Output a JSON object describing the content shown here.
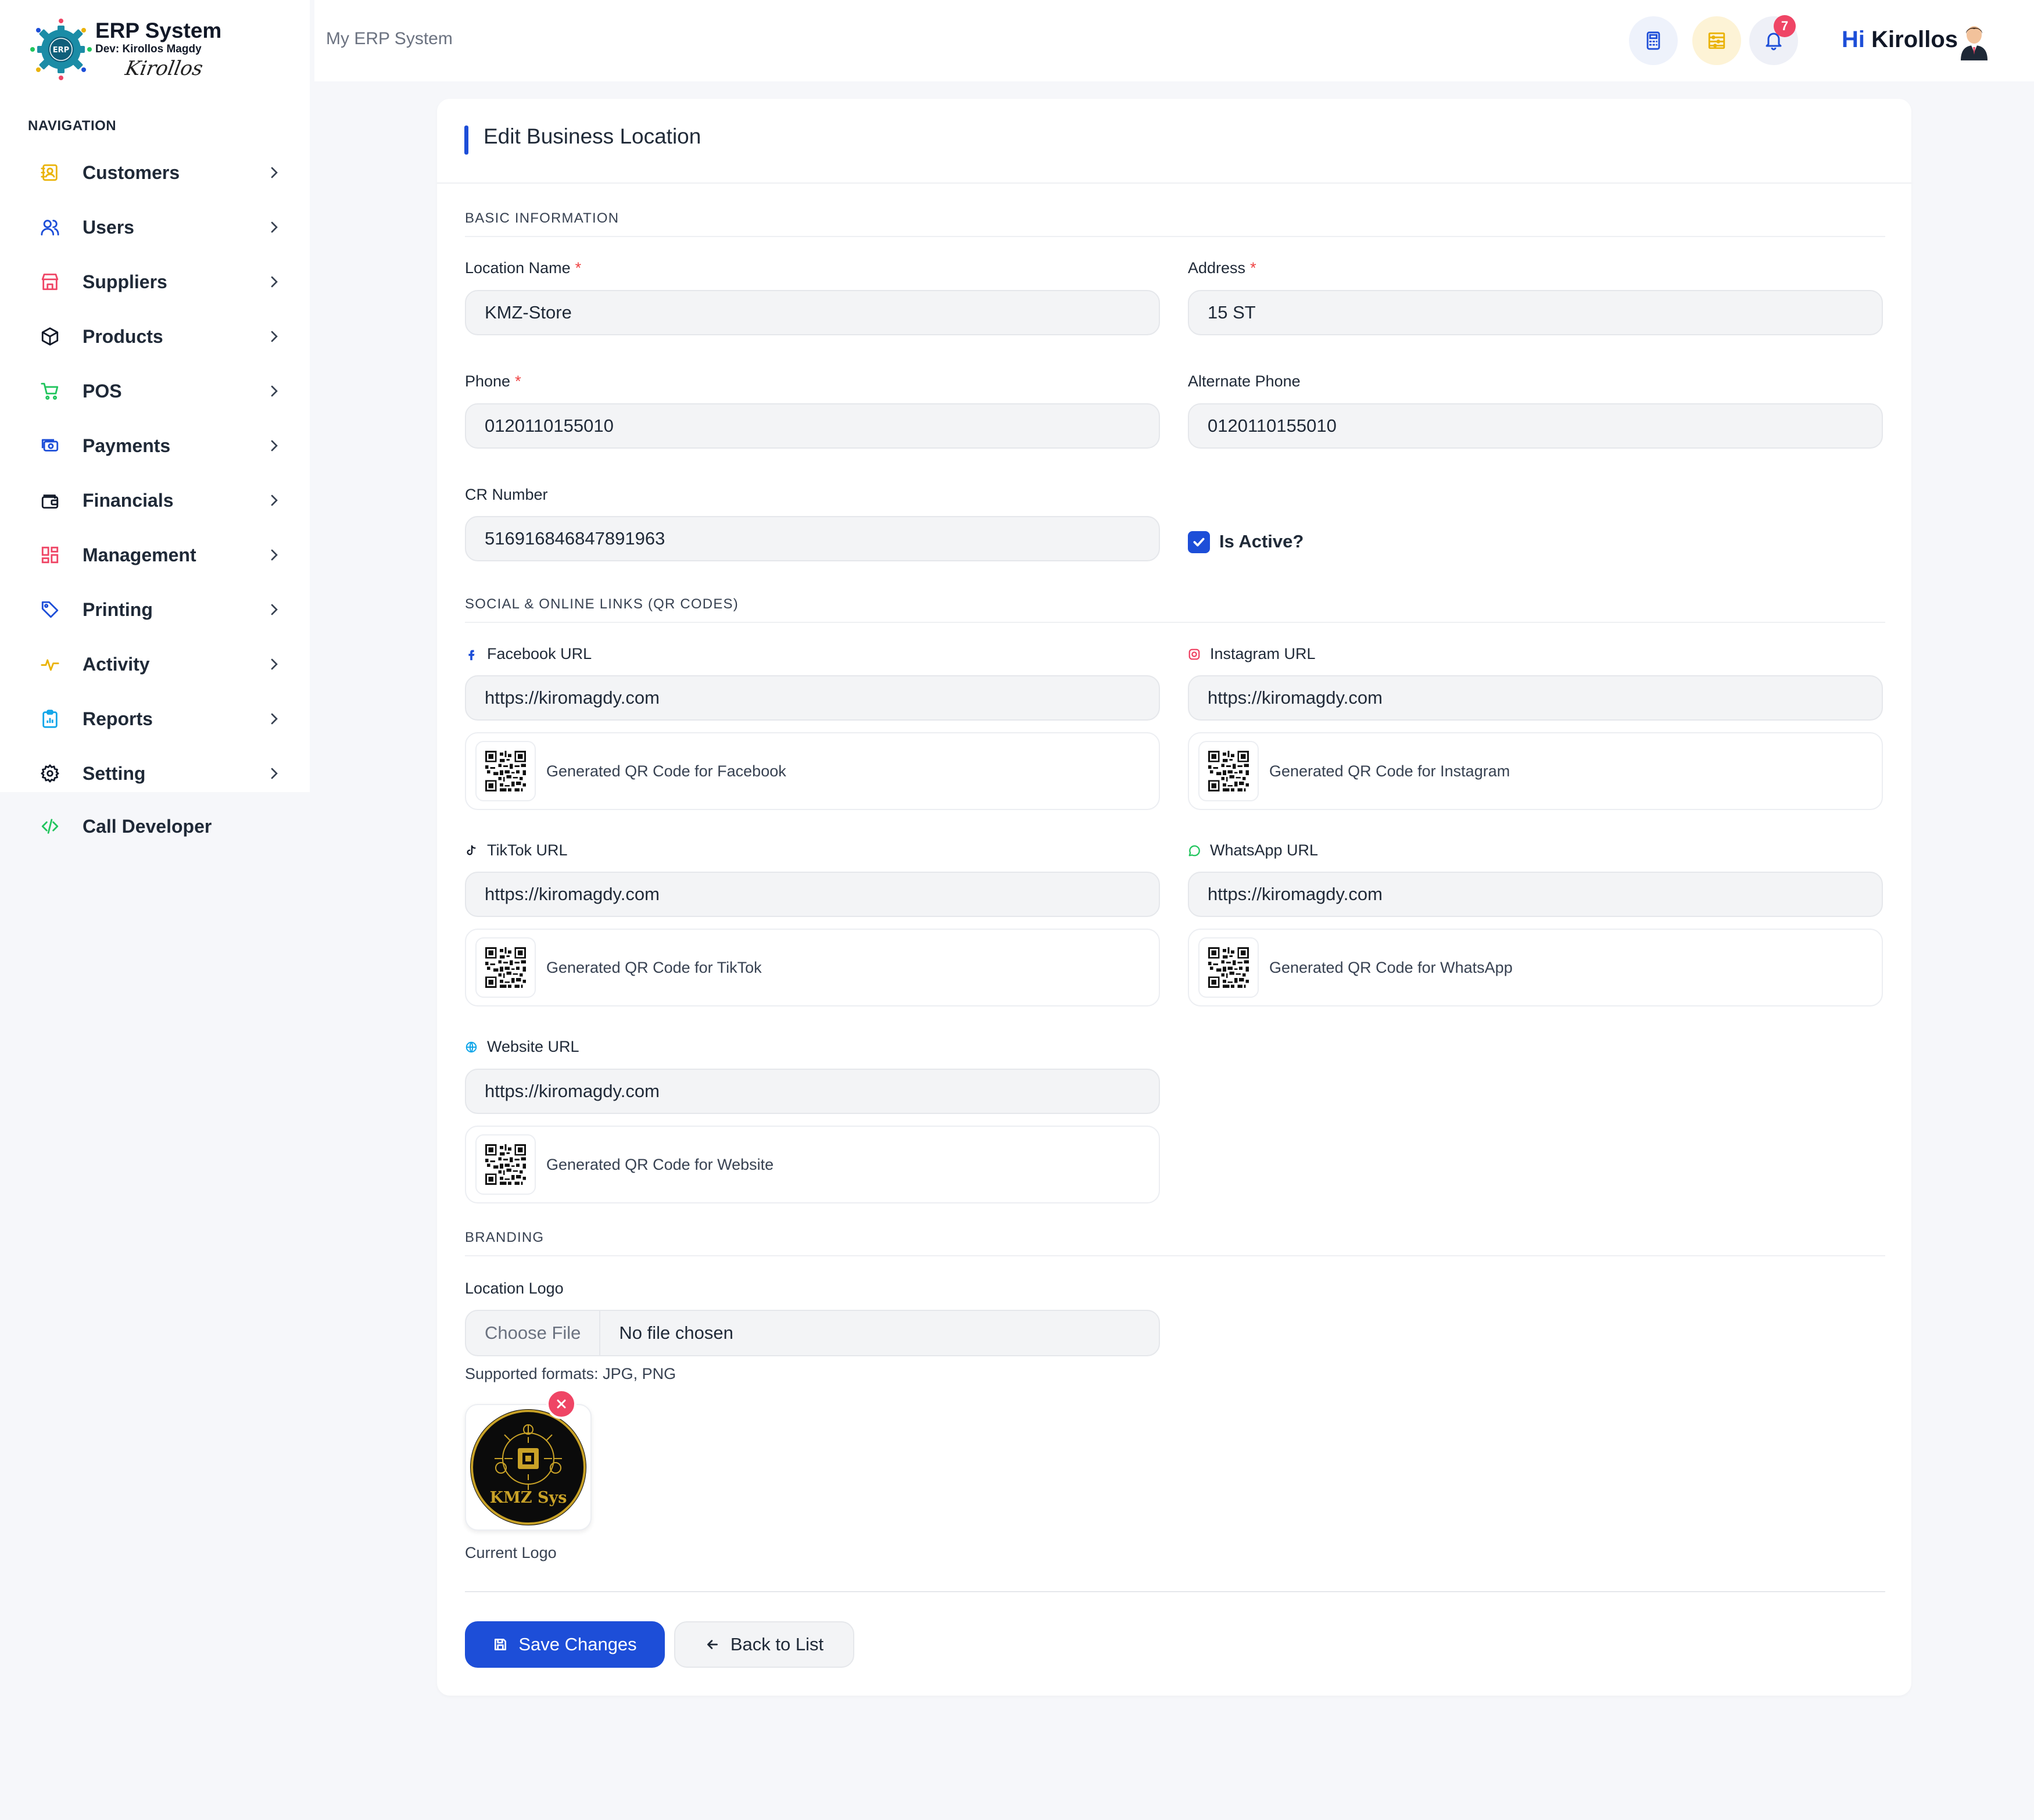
{
  "brand": {
    "title": "ERP System",
    "developer": "Dev: Kirollos Magdy",
    "signature": "Kirollos",
    "logo_text": "ERP"
  },
  "sidebar": {
    "heading": "NAVIGATION",
    "items": [
      {
        "label": "Customers",
        "icon": "address-book-icon",
        "color": "#eab308"
      },
      {
        "label": "Users",
        "icon": "users-icon",
        "color": "#1d4ed8"
      },
      {
        "label": "Suppliers",
        "icon": "store-icon",
        "color": "#ef4565"
      },
      {
        "label": "Products",
        "icon": "box-icon",
        "color": "#111827"
      },
      {
        "label": "POS",
        "icon": "cart-icon",
        "color": "#22c55e"
      },
      {
        "label": "Payments",
        "icon": "money-icon",
        "color": "#1d4ed8"
      },
      {
        "label": "Financials",
        "icon": "wallet-icon",
        "color": "#111827"
      },
      {
        "label": "Management",
        "icon": "grid-icon",
        "color": "#ef4565"
      },
      {
        "label": "Printing",
        "icon": "tag-icon",
        "color": "#1d4ed8"
      },
      {
        "label": "Activity",
        "icon": "activity-icon",
        "color": "#eab308"
      },
      {
        "label": "Reports",
        "icon": "clipboard-chart-icon",
        "color": "#0ea5e9"
      },
      {
        "label": "Setting",
        "icon": "gear-icon",
        "color": "#111827"
      }
    ],
    "call_developer": {
      "label": "Call Developer",
      "icon": "code-icon",
      "color": "#22c55e"
    }
  },
  "topbar": {
    "breadcrumb": "My ERP System",
    "calculator_icon": "calculator-icon",
    "abacus_icon": "abacus-icon",
    "bell_icon": "bell-icon",
    "notification_count": "7",
    "greeting_hi": "Hi",
    "greeting_name": "Kirollos"
  },
  "form": {
    "title": "Edit Business Location",
    "sections": {
      "basic": "BASIC INFORMATION",
      "social": "SOCIAL & ONLINE LINKS (QR CODES)",
      "branding": "BRANDING"
    },
    "fields": {
      "location_name": {
        "label": "Location Name",
        "required": "*",
        "value": "KMZ-Store"
      },
      "address": {
        "label": "Address",
        "required": "*",
        "value": "15 ST"
      },
      "phone": {
        "label": "Phone",
        "required": "*",
        "value": "0120110155010"
      },
      "alternate_phone": {
        "label": "Alternate Phone",
        "value": "0120110155010"
      },
      "cr_number": {
        "label": "CR Number",
        "value": "516916846847891963"
      },
      "is_active": {
        "label": "Is Active?",
        "checked": true
      }
    },
    "social": {
      "facebook": {
        "label": "Facebook URL",
        "icon": "facebook-icon",
        "value": "https://kiromagdy.com",
        "qr_text": "Generated QR Code for Facebook"
      },
      "instagram": {
        "label": "Instagram URL",
        "icon": "instagram-icon",
        "value": "https://kiromagdy.com",
        "qr_text": "Generated QR Code for Instagram"
      },
      "tiktok": {
        "label": "TikTok URL",
        "icon": "tiktok-icon",
        "value": "https://kiromagdy.com",
        "qr_text": "Generated QR Code for TikTok"
      },
      "whatsapp": {
        "label": "WhatsApp URL",
        "icon": "whatsapp-icon",
        "value": "https://kiromagdy.com",
        "qr_text": "Generated QR Code for WhatsApp"
      },
      "website": {
        "label": "Website URL",
        "icon": "globe-icon",
        "value": "https://kiromagdy.com",
        "qr_text": "Generated QR Code for Website"
      }
    },
    "branding": {
      "logo_label": "Location Logo",
      "file_button": "Choose File",
      "file_name": "No file chosen",
      "hint": "Supported formats: JPG, PNG",
      "logo_text": "KMZ Sys",
      "current_logo": "Current Logo"
    },
    "actions": {
      "save": "Save Changes",
      "back": "Back to List"
    }
  },
  "colors": {
    "accent": "#1d4ed8",
    "danger": "#ef4565",
    "page_bg": "#f6f7fa"
  }
}
